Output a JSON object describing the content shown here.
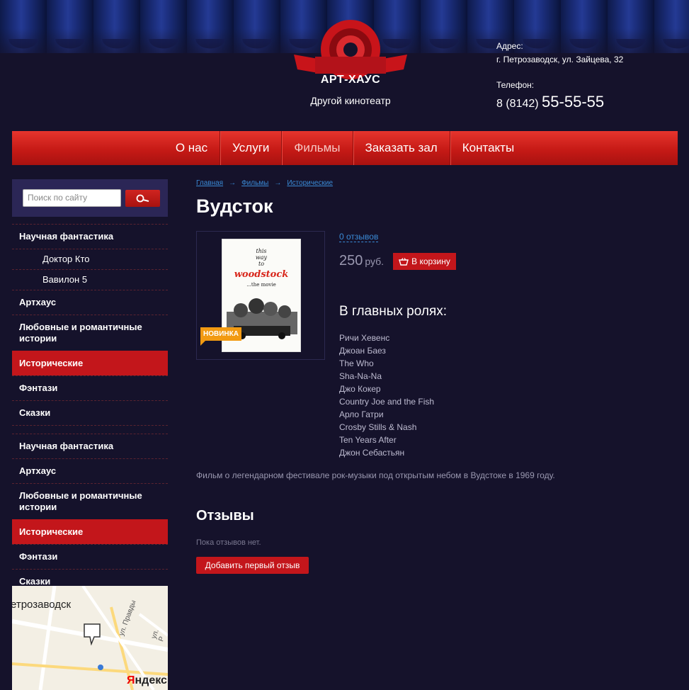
{
  "header": {
    "logo_text": "АРТ-ХАУС",
    "logo_subtitle": "Другой кинотеатр",
    "address_label": "Адрес:",
    "address": "г. Петрозаводск, ул. Зайцева, 32",
    "phone_label": "Телефон:",
    "phone_code": "8 (8142)",
    "phone_number": "55-55-55"
  },
  "nav": {
    "items": [
      "О нас",
      "Услуги",
      "Фильмы",
      "Заказать зал",
      "Контакты"
    ],
    "active": "Фильмы"
  },
  "search": {
    "placeholder": "Поиск по сайту",
    "icon": "search-icon"
  },
  "sidebar": {
    "group1": [
      {
        "label": "Научная фантастика"
      },
      {
        "label": "Доктор Кто"
      },
      {
        "label": "Вавилон 5"
      },
      {
        "label": "Артхаус"
      },
      {
        "label": "Любовные и романтичные истории"
      },
      {
        "label": "Исторические"
      },
      {
        "label": "Фэнтази"
      },
      {
        "label": "Сказки"
      }
    ],
    "group2": [
      {
        "label": "Научная фантастика"
      },
      {
        "label": "Артхаус"
      },
      {
        "label": "Любовные и романтичные истории"
      },
      {
        "label": "Исторические"
      },
      {
        "label": "Фэнтази"
      },
      {
        "label": "Сказки"
      }
    ]
  },
  "map": {
    "city_label": "етрозаводск",
    "street1": "ул. Правды",
    "street2": "ул. Р",
    "logo_first": "Я",
    "logo_rest": "ндекс"
  },
  "breadcrumbs": [
    "Главная",
    "Фильмы",
    "Исторические"
  ],
  "breadcrumb_sep": "→",
  "product": {
    "title": "Вудсток",
    "badge": "НОВИНКА",
    "reviews_link": "0 отзывов",
    "price": "250",
    "currency": "руб.",
    "cart_button": "В корзину",
    "poster": {
      "line1": "this",
      "line2": "way",
      "line3": "to",
      "brand": "woodstock",
      "tagline": "...the movie"
    },
    "cast_title": "В главных ролях:",
    "cast": [
      "Ричи Хевенс",
      "Джоан Баез",
      "The Who",
      "Sha-Na-Na",
      "Джо Кокер",
      "Country Joe and the Fish",
      "Арло Гатри",
      "Crosby Stills & Nash",
      "Ten Years After",
      "Джон Себастьян"
    ],
    "description": "Фильм о легендарном фестивале рок-музыки под открытым небом в Вудстоке в 1969 году."
  },
  "reviews": {
    "title": "Отзывы",
    "empty_text": "Пока отзывов нет.",
    "add_button": "Добавить первый отзыв"
  },
  "colors": {
    "background": "#15122b",
    "accent_red": "#c3161b",
    "link_blue": "#3a8ad6",
    "badge_orange": "#f29a12"
  }
}
